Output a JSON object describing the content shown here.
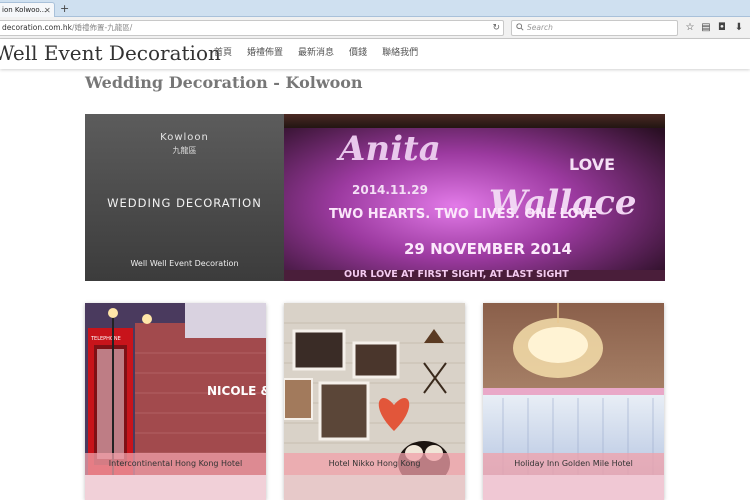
{
  "browser": {
    "tab_title": "ion Kolwoo...",
    "url_domain": "decoration.com.hk",
    "url_path": "/婚禮佈置-九龍區/",
    "search_placeholder": "Search"
  },
  "site": {
    "brand": "Well Event Decoration",
    "menu": [
      "首頁",
      "婚禮佈置",
      "最新消息",
      "價錢",
      "聯絡我們"
    ]
  },
  "page": {
    "title": "Wedding Decoration - Kolwoon"
  },
  "banner": {
    "area_en": "Kowloon",
    "area_zh": "九龍區",
    "heading": "WEDDING DECORATION",
    "brand": "Well Well Event Decoration",
    "photo_text": {
      "names_1": "Anita",
      "names_2": "Wallace",
      "love": "LOVE",
      "date": "2014.11.29",
      "line1": "TWO HEARTS. TWO LIVES. ONE LOVE",
      "line2": "29 NOVEMBER 2014",
      "line3": "OUR LOVE AT FIRST SIGHT, AT LAST SIGHT"
    }
  },
  "cards": [
    {
      "caption": "Intercontinental Hong Kong Hotel",
      "sign_text": "NICOLE &",
      "booth_text": "TELEPHONE"
    },
    {
      "caption": "Hotel Nikko Hong Kong"
    },
    {
      "caption": "Holiday Inn Golden Mile Hotel"
    }
  ],
  "colors": {
    "banner_dark": "#4a4a4a",
    "caption_pink": "#f0a0aa",
    "brand_text": "#333333",
    "title_text": "#777777"
  }
}
